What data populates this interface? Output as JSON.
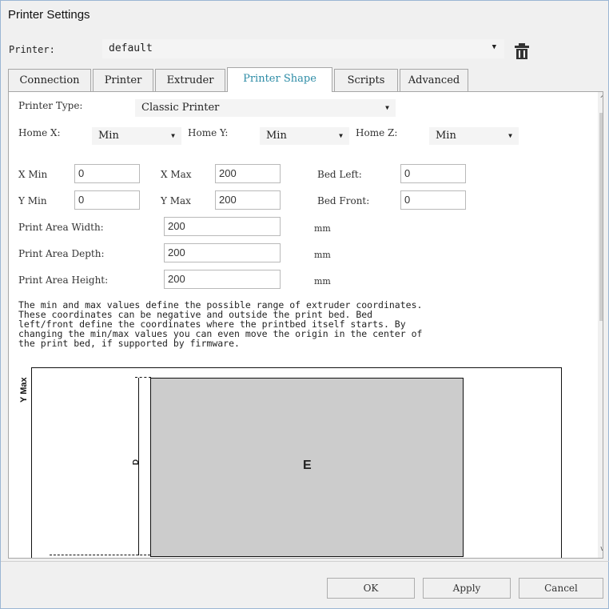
{
  "window": {
    "title": "Printer Settings"
  },
  "printer": {
    "label": "Printer:",
    "value": "default",
    "icons": {
      "dropdown": "chevron-down-icon",
      "delete": "trash-icon"
    }
  },
  "tabs": [
    {
      "label": "Connection"
    },
    {
      "label": "Printer"
    },
    {
      "label": "Extruder"
    },
    {
      "label": "Printer Shape",
      "active": true
    },
    {
      "label": "Scripts"
    },
    {
      "label": "Advanced"
    }
  ],
  "shape": {
    "type_label": "Printer Type:",
    "type_value": "Classic Printer",
    "home_x_label": "Home X:",
    "home_x_value": "Min",
    "home_y_label": "Home Y:",
    "home_y_value": "Min",
    "home_z_label": "Home Z:",
    "home_z_value": "Min",
    "xmin_label": "X Min",
    "xmin_value": "0",
    "xmax_label": "X Max",
    "xmax_value": "200",
    "bedleft_label": "Bed Left:",
    "bedleft_value": "0",
    "ymin_label": "Y Min",
    "ymin_value": "0",
    "ymax_label": "Y Max",
    "ymax_value": "200",
    "bedfront_label": "Bed Front:",
    "bedfront_value": "0",
    "width_label": "Print Area Width:",
    "width_value": "200",
    "depth_label": "Print Area Depth:",
    "depth_value": "200",
    "height_label": "Print Area Height:",
    "height_value": "200",
    "unit": "mm",
    "description": "The min and max values define the possible range of extruder coordinates.\nThese coordinates can be negative and outside the print bed. Bed\nleft/front define the coordinates where the printbed itself starts. By\nchanging the min/max values you can even move the origin in the center of\nthe print bed, if supported by firmware."
  },
  "diagram": {
    "ymax_label": "Y Max",
    "d_label": "D",
    "bed_label": "E"
  },
  "buttons": {
    "ok": "OK",
    "apply": "Apply",
    "cancel": "Cancel"
  },
  "colors": {
    "active_tab": "#2d8ca6",
    "bed": "#cccccc",
    "border": "#9bb6d4"
  }
}
